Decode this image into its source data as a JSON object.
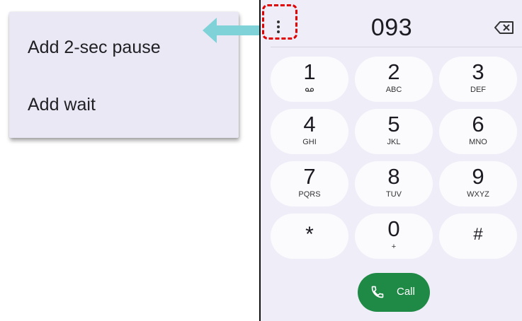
{
  "menu": {
    "items": [
      {
        "label": "Add 2-sec pause"
      },
      {
        "label": "Add wait"
      }
    ]
  },
  "dialer": {
    "number": "093",
    "keys": [
      {
        "digit": "1",
        "letters": ""
      },
      {
        "digit": "2",
        "letters": "ABC"
      },
      {
        "digit": "3",
        "letters": "DEF"
      },
      {
        "digit": "4",
        "letters": "GHI"
      },
      {
        "digit": "5",
        "letters": "JKL"
      },
      {
        "digit": "6",
        "letters": "MNO"
      },
      {
        "digit": "7",
        "letters": "PQRS"
      },
      {
        "digit": "8",
        "letters": "TUV"
      },
      {
        "digit": "9",
        "letters": "WXYZ"
      },
      {
        "digit": "*",
        "letters": ""
      },
      {
        "digit": "0",
        "letters": "+"
      },
      {
        "digit": "#",
        "letters": ""
      }
    ],
    "call_label": "Call"
  },
  "icons": {
    "overflow": "more-vert-icon",
    "backspace": "backspace-icon",
    "voicemail": "voicemail-icon",
    "call": "phone-icon"
  },
  "colors": {
    "call_button": "#1f8a46",
    "highlight": "#e00000",
    "arrow": "#7fd3d8"
  }
}
